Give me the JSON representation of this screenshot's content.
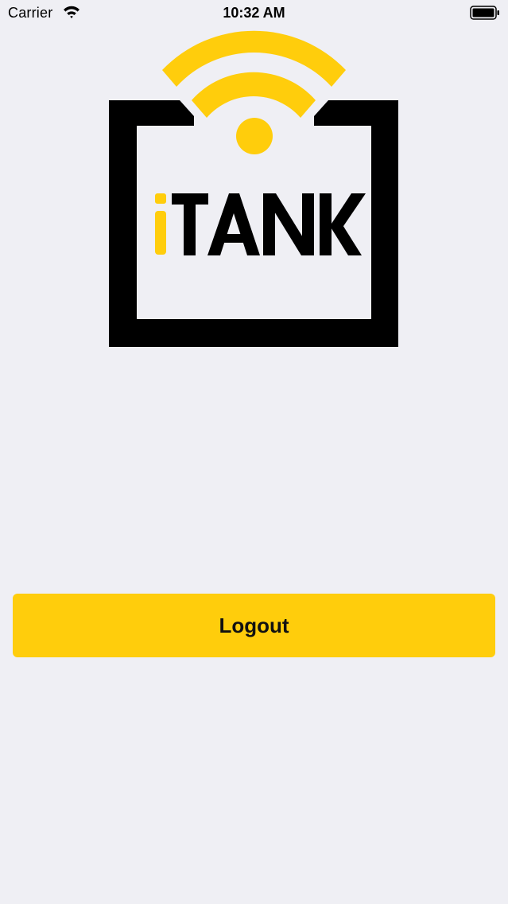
{
  "status_bar": {
    "carrier": "Carrier",
    "time": "10:32 AM",
    "wifi_icon": "wifi-icon",
    "battery_icon": "battery-icon"
  },
  "logo": {
    "text": "iTANK",
    "accent_color": "#ffcd0c",
    "frame_color": "#000000"
  },
  "actions": {
    "logout_label": "Logout"
  },
  "colors": {
    "background": "#efeff4",
    "button": "#ffcd0c"
  }
}
